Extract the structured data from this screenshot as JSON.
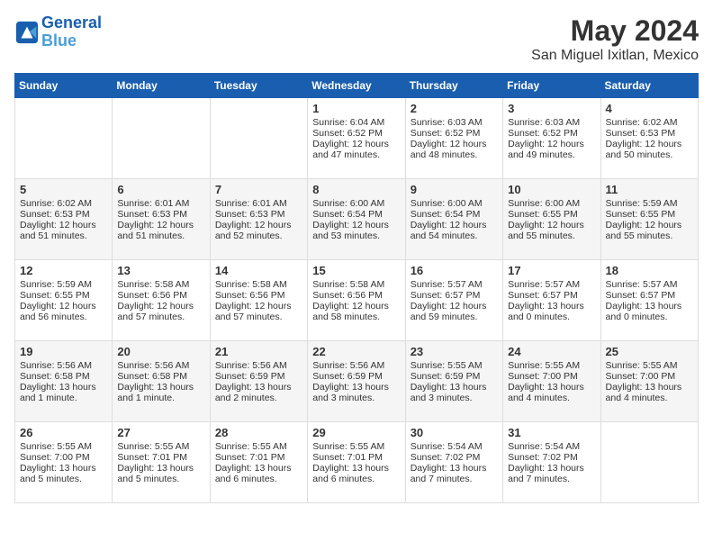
{
  "header": {
    "logo_line1": "General",
    "logo_line2": "Blue",
    "month": "May 2024",
    "location": "San Miguel Ixitlan, Mexico"
  },
  "weekdays": [
    "Sunday",
    "Monday",
    "Tuesday",
    "Wednesday",
    "Thursday",
    "Friday",
    "Saturday"
  ],
  "weeks": [
    [
      {
        "day": "",
        "info": ""
      },
      {
        "day": "",
        "info": ""
      },
      {
        "day": "",
        "info": ""
      },
      {
        "day": "1",
        "sunrise": "Sunrise: 6:04 AM",
        "sunset": "Sunset: 6:52 PM",
        "daylight": "Daylight: 12 hours and 47 minutes."
      },
      {
        "day": "2",
        "sunrise": "Sunrise: 6:03 AM",
        "sunset": "Sunset: 6:52 PM",
        "daylight": "Daylight: 12 hours and 48 minutes."
      },
      {
        "day": "3",
        "sunrise": "Sunrise: 6:03 AM",
        "sunset": "Sunset: 6:52 PM",
        "daylight": "Daylight: 12 hours and 49 minutes."
      },
      {
        "day": "4",
        "sunrise": "Sunrise: 6:02 AM",
        "sunset": "Sunset: 6:53 PM",
        "daylight": "Daylight: 12 hours and 50 minutes."
      }
    ],
    [
      {
        "day": "5",
        "sunrise": "Sunrise: 6:02 AM",
        "sunset": "Sunset: 6:53 PM",
        "daylight": "Daylight: 12 hours and 51 minutes."
      },
      {
        "day": "6",
        "sunrise": "Sunrise: 6:01 AM",
        "sunset": "Sunset: 6:53 PM",
        "daylight": "Daylight: 12 hours and 51 minutes."
      },
      {
        "day": "7",
        "sunrise": "Sunrise: 6:01 AM",
        "sunset": "Sunset: 6:53 PM",
        "daylight": "Daylight: 12 hours and 52 minutes."
      },
      {
        "day": "8",
        "sunrise": "Sunrise: 6:00 AM",
        "sunset": "Sunset: 6:54 PM",
        "daylight": "Daylight: 12 hours and 53 minutes."
      },
      {
        "day": "9",
        "sunrise": "Sunrise: 6:00 AM",
        "sunset": "Sunset: 6:54 PM",
        "daylight": "Daylight: 12 hours and 54 minutes."
      },
      {
        "day": "10",
        "sunrise": "Sunrise: 6:00 AM",
        "sunset": "Sunset: 6:55 PM",
        "daylight": "Daylight: 12 hours and 55 minutes."
      },
      {
        "day": "11",
        "sunrise": "Sunrise: 5:59 AM",
        "sunset": "Sunset: 6:55 PM",
        "daylight": "Daylight: 12 hours and 55 minutes."
      }
    ],
    [
      {
        "day": "12",
        "sunrise": "Sunrise: 5:59 AM",
        "sunset": "Sunset: 6:55 PM",
        "daylight": "Daylight: 12 hours and 56 minutes."
      },
      {
        "day": "13",
        "sunrise": "Sunrise: 5:58 AM",
        "sunset": "Sunset: 6:56 PM",
        "daylight": "Daylight: 12 hours and 57 minutes."
      },
      {
        "day": "14",
        "sunrise": "Sunrise: 5:58 AM",
        "sunset": "Sunset: 6:56 PM",
        "daylight": "Daylight: 12 hours and 57 minutes."
      },
      {
        "day": "15",
        "sunrise": "Sunrise: 5:58 AM",
        "sunset": "Sunset: 6:56 PM",
        "daylight": "Daylight: 12 hours and 58 minutes."
      },
      {
        "day": "16",
        "sunrise": "Sunrise: 5:57 AM",
        "sunset": "Sunset: 6:57 PM",
        "daylight": "Daylight: 12 hours and 59 minutes."
      },
      {
        "day": "17",
        "sunrise": "Sunrise: 5:57 AM",
        "sunset": "Sunset: 6:57 PM",
        "daylight": "Daylight: 13 hours and 0 minutes."
      },
      {
        "day": "18",
        "sunrise": "Sunrise: 5:57 AM",
        "sunset": "Sunset: 6:57 PM",
        "daylight": "Daylight: 13 hours and 0 minutes."
      }
    ],
    [
      {
        "day": "19",
        "sunrise": "Sunrise: 5:56 AM",
        "sunset": "Sunset: 6:58 PM",
        "daylight": "Daylight: 13 hours and 1 minute."
      },
      {
        "day": "20",
        "sunrise": "Sunrise: 5:56 AM",
        "sunset": "Sunset: 6:58 PM",
        "daylight": "Daylight: 13 hours and 1 minute."
      },
      {
        "day": "21",
        "sunrise": "Sunrise: 5:56 AM",
        "sunset": "Sunset: 6:59 PM",
        "daylight": "Daylight: 13 hours and 2 minutes."
      },
      {
        "day": "22",
        "sunrise": "Sunrise: 5:56 AM",
        "sunset": "Sunset: 6:59 PM",
        "daylight": "Daylight: 13 hours and 3 minutes."
      },
      {
        "day": "23",
        "sunrise": "Sunrise: 5:55 AM",
        "sunset": "Sunset: 6:59 PM",
        "daylight": "Daylight: 13 hours and 3 minutes."
      },
      {
        "day": "24",
        "sunrise": "Sunrise: 5:55 AM",
        "sunset": "Sunset: 7:00 PM",
        "daylight": "Daylight: 13 hours and 4 minutes."
      },
      {
        "day": "25",
        "sunrise": "Sunrise: 5:55 AM",
        "sunset": "Sunset: 7:00 PM",
        "daylight": "Daylight: 13 hours and 4 minutes."
      }
    ],
    [
      {
        "day": "26",
        "sunrise": "Sunrise: 5:55 AM",
        "sunset": "Sunset: 7:00 PM",
        "daylight": "Daylight: 13 hours and 5 minutes."
      },
      {
        "day": "27",
        "sunrise": "Sunrise: 5:55 AM",
        "sunset": "Sunset: 7:01 PM",
        "daylight": "Daylight: 13 hours and 5 minutes."
      },
      {
        "day": "28",
        "sunrise": "Sunrise: 5:55 AM",
        "sunset": "Sunset: 7:01 PM",
        "daylight": "Daylight: 13 hours and 6 minutes."
      },
      {
        "day": "29",
        "sunrise": "Sunrise: 5:55 AM",
        "sunset": "Sunset: 7:01 PM",
        "daylight": "Daylight: 13 hours and 6 minutes."
      },
      {
        "day": "30",
        "sunrise": "Sunrise: 5:54 AM",
        "sunset": "Sunset: 7:02 PM",
        "daylight": "Daylight: 13 hours and 7 minutes."
      },
      {
        "day": "31",
        "sunrise": "Sunrise: 5:54 AM",
        "sunset": "Sunset: 7:02 PM",
        "daylight": "Daylight: 13 hours and 7 minutes."
      },
      {
        "day": "",
        "info": ""
      }
    ]
  ]
}
